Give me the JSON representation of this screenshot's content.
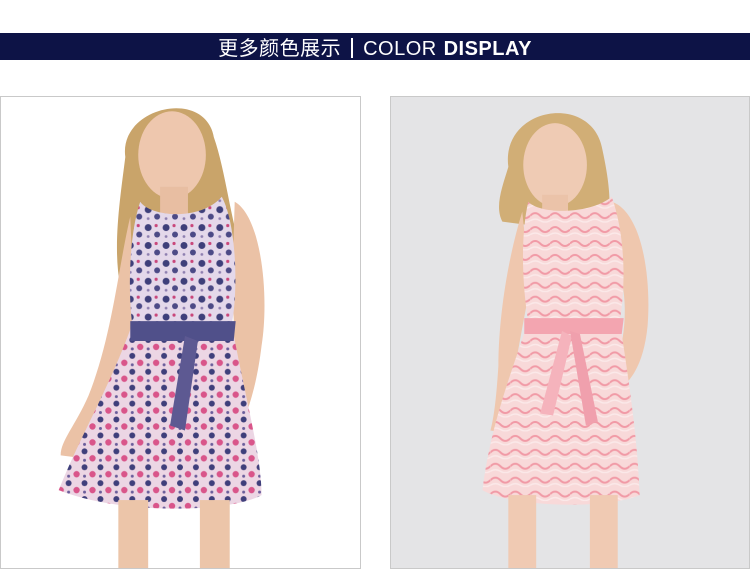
{
  "banner": {
    "cn_text": "更多颜色展示",
    "en_light": "COLOR",
    "en_bold": "DISPLAY",
    "background_color": "#0d1346",
    "text_color": "#ffffff"
  },
  "products": [
    {
      "variant": "navy-floral-print-dress",
      "accent_color": "#4a4a82"
    },
    {
      "variant": "pink-print-dress",
      "accent_color": "#f3b9bf"
    }
  ]
}
